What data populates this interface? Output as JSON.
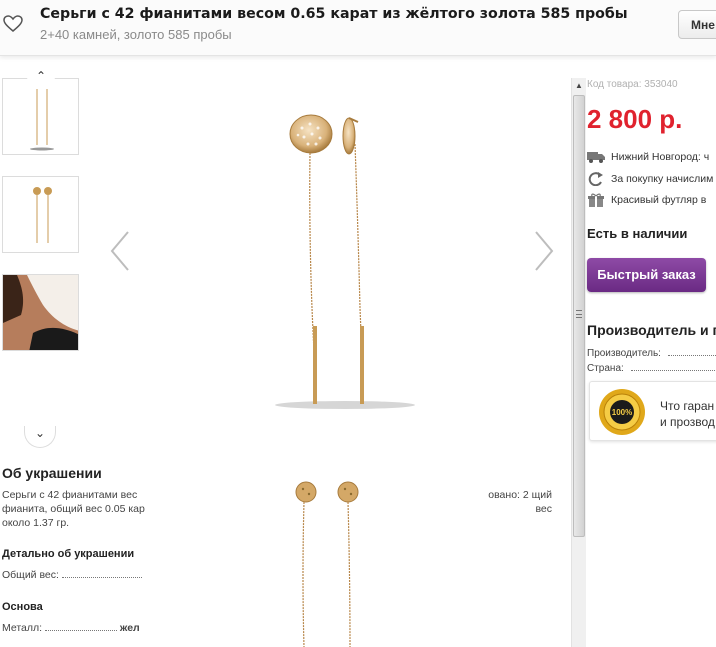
{
  "header": {
    "title": "Серьги с 42 фианитами весом 0.65 карат из жёлтого золота 585 пробы",
    "subtitle": "2+40 камней, золото 585 пробы",
    "more_button": "Мне"
  },
  "description": {
    "heading": "Об украшении",
    "text_left": "Серьги с 42 фианитами вес фианита, общий вес 0.05 кар около 1.37 гр.",
    "text_right": "овано: 2 щий вес",
    "details_heading": "Детально об украшении",
    "weight_label": "Общий вес:",
    "base_heading": "Основа",
    "metal_label": "Металл:",
    "metal_value": "жел"
  },
  "sidebar": {
    "sku": "Код товара: 353040",
    "price": "2 800 р.",
    "features": [
      {
        "icon": "truck-icon",
        "text": "Нижний Новгород: ч"
      },
      {
        "icon": "refresh-icon",
        "text": "За покупку начислим"
      },
      {
        "icon": "gift-icon",
        "text": "Красивый футляр в"
      }
    ],
    "stock": "Есть в наличии",
    "quick_order": "Быстрый заказ",
    "maker_heading": "Производитель и п",
    "maker_label": "Производитель:",
    "country_label": "Страна:",
    "guarantee_text_1": "Что гаран",
    "guarantee_text_2": "и прозвод",
    "guarantee_badge": "100%"
  },
  "colors": {
    "price": "#e0222e",
    "quick_order": "#7b3996",
    "gold": "#c89b55"
  }
}
